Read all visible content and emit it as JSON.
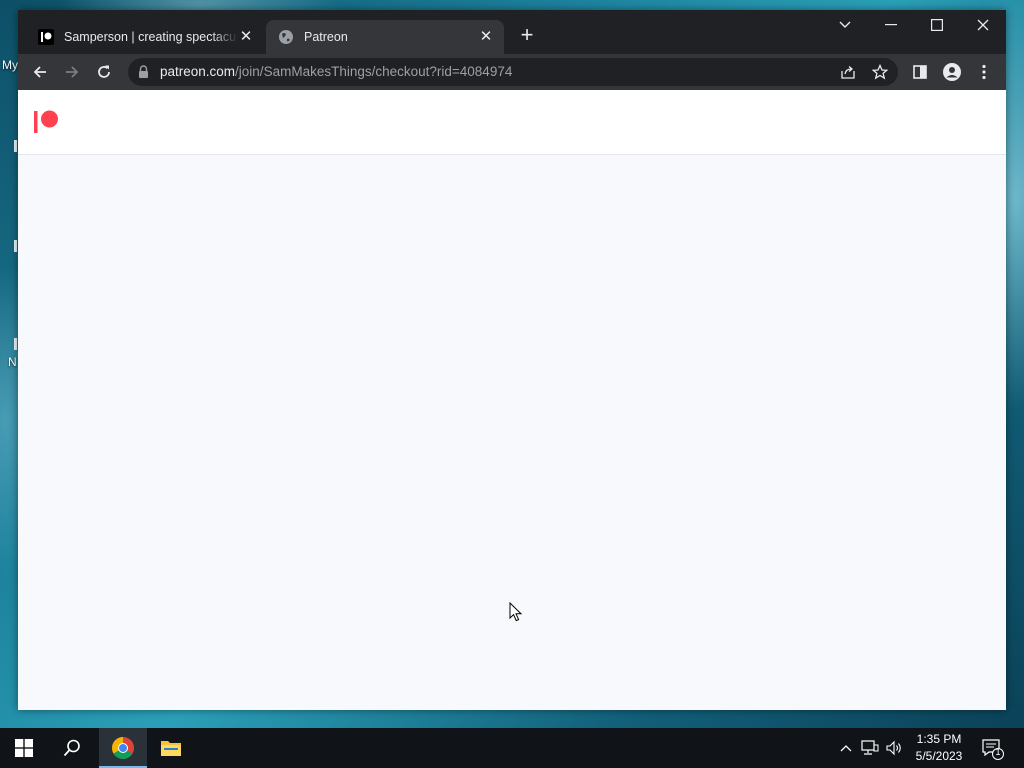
{
  "desktop": {
    "labels": [
      "My",
      "N"
    ]
  },
  "browser": {
    "tabs": [
      {
        "title": "Samperson | creating spectacular",
        "favicon": "patreon-icon",
        "active": false
      },
      {
        "title": "Patreon",
        "favicon": "globe-icon",
        "active": true
      }
    ],
    "url_host": "patreon.com",
    "url_path": "/join/SamMakesThings/checkout?rid=4084974"
  },
  "page": {
    "logo": "patreon-logo",
    "brand_color": "#ff424d"
  },
  "taskbar": {
    "time": "1:35 PM",
    "date": "5/5/2023",
    "notification_count": "1"
  }
}
